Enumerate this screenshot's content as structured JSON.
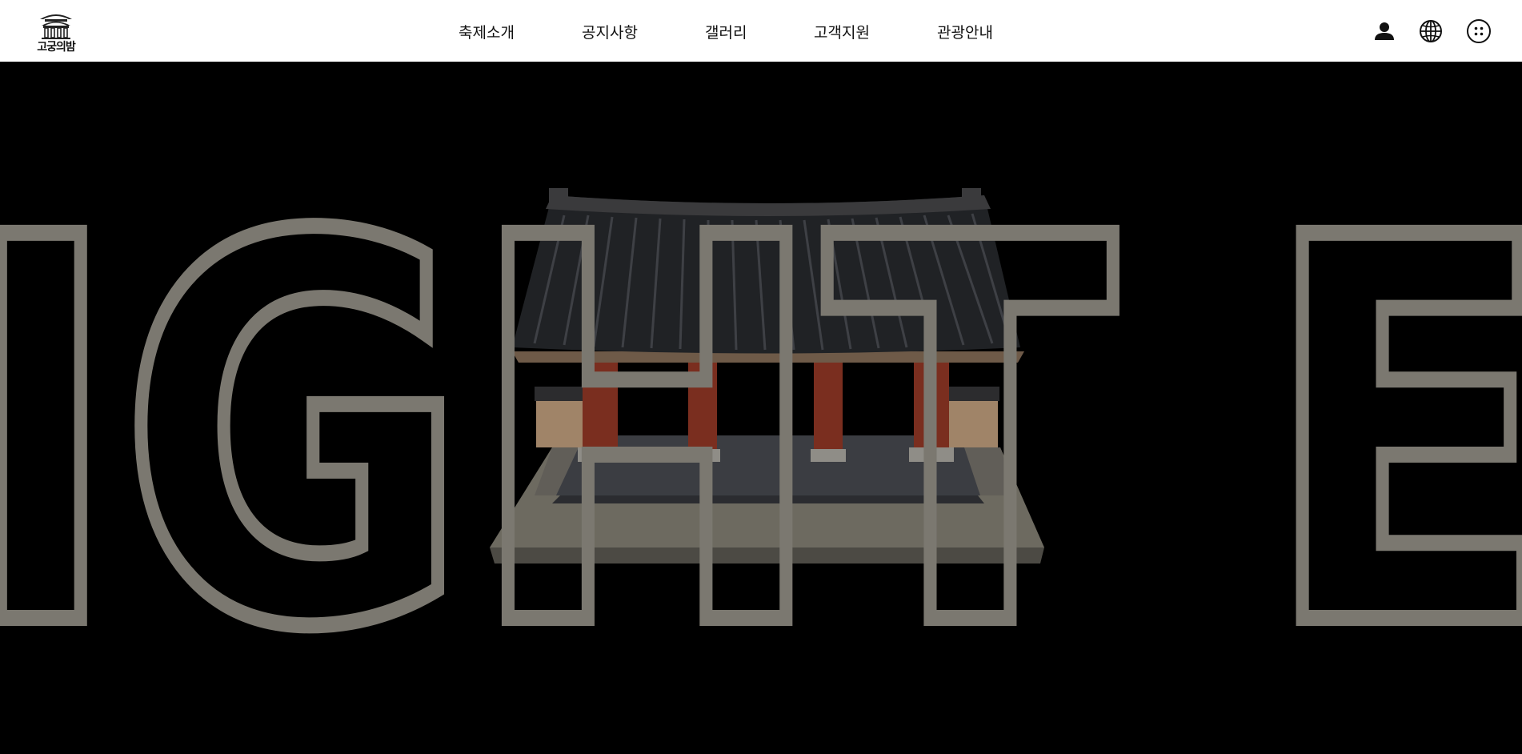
{
  "header": {
    "logo": {
      "text": "고궁의밤",
      "icon": "palace-gate-icon"
    },
    "nav": [
      {
        "label": "축제소개"
      },
      {
        "label": "공지사항"
      },
      {
        "label": "갤러리"
      },
      {
        "label": "고객지원"
      },
      {
        "label": "관광안내"
      }
    ],
    "utilities": [
      {
        "name": "user-icon"
      },
      {
        "name": "globe-icon"
      },
      {
        "name": "menu-grid-icon"
      }
    ]
  },
  "hero": {
    "outline_text": "IGHT E",
    "image": "palace-gate-3d-model",
    "colors": {
      "background": "#000000",
      "outline_stroke": "#7b7870"
    }
  }
}
